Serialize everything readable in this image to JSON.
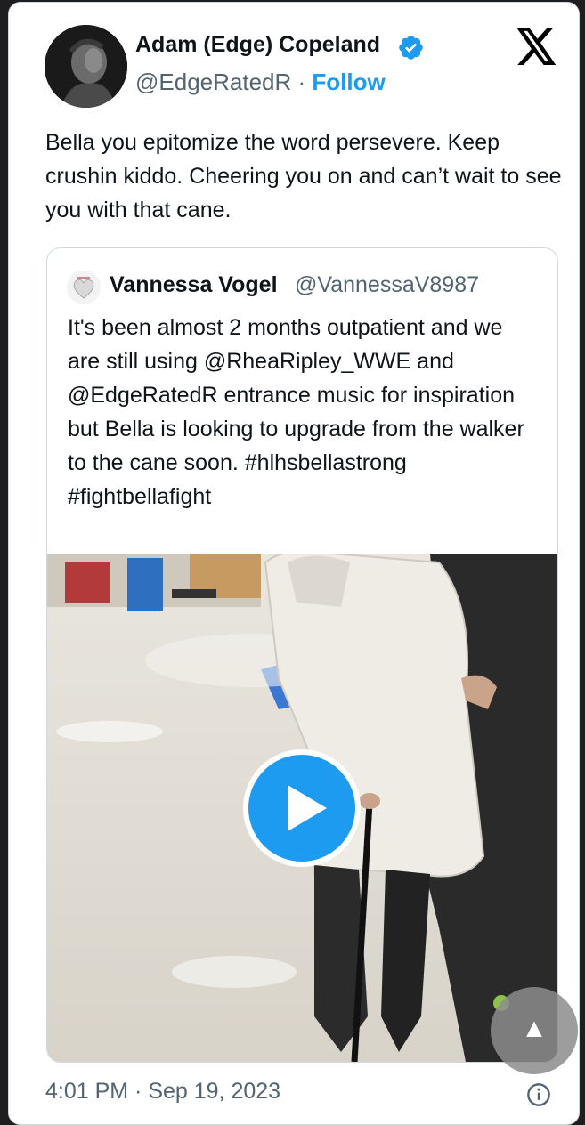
{
  "tweet": {
    "author_name": "Adam (Edge) Copeland",
    "handle": "@EdgeRatedR",
    "separator": "·",
    "follow_label": "Follow",
    "text": "Bella you epitomize the word persevere. Keep crushin kiddo. Cheering you on and can’t wait to see you with that cane.",
    "timestamp": "4:01 PM · Sep 19, 2023"
  },
  "quoted_tweet": {
    "author_name": "Vannessa Vogel",
    "handle": "@VannessaV8987",
    "text": "It's been almost 2 months outpatient and we are still using @RheaRipley_WWE and @EdgeRatedR entrance music for inspiration but Bella is looking to upgrade from the walker to the cane soon. #hlhsbellastrong #fightbellafight"
  },
  "icons": {
    "verified": "verified-badge-icon",
    "brand": "x-logo-icon",
    "play": "play-icon",
    "info": "info-icon",
    "scroll_top": "up-arrow-icon"
  },
  "colors": {
    "accent": "#1d9bf0",
    "text": "#0f1419",
    "secondary": "#536471",
    "border": "#cfd9de"
  }
}
